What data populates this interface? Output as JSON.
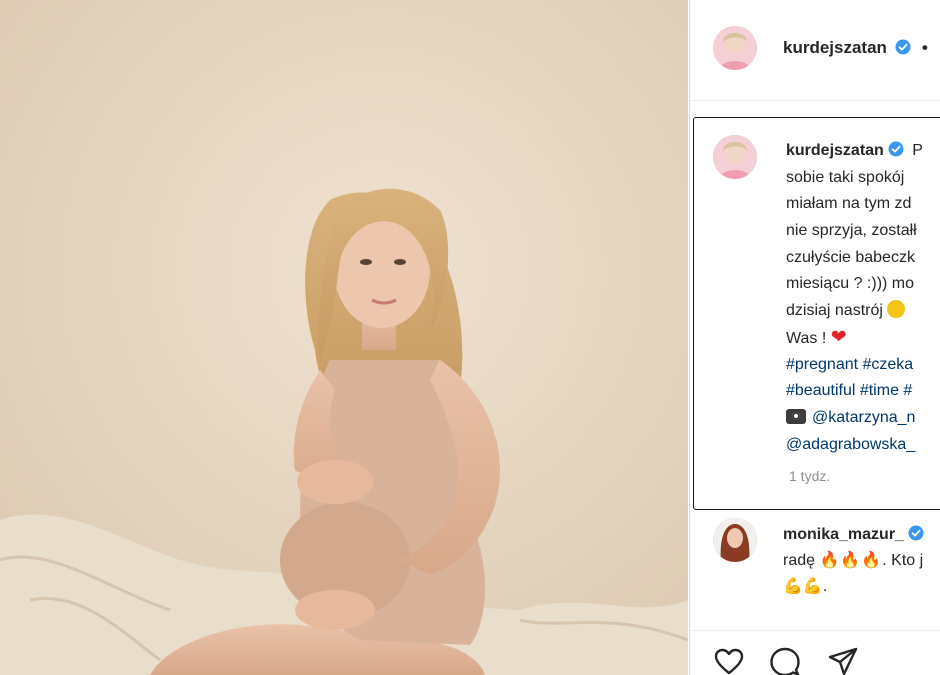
{
  "post": {
    "username": "kurdejszatan",
    "header_separator": "•",
    "caption_lines": [
      "P",
      "sobie taki spokój",
      "miałam na tym zd",
      "nie sprzyja, zostałł",
      "czułyście babeczk",
      "miesiącu ? :))) mo",
      "dzisiaj nastrój",
      "Was !"
    ],
    "hashtag_lines": [
      "#pregnant #czeka",
      "#beautiful #time #"
    ],
    "mention_lines": [
      "@katarzyna_n",
      "@adagrabowska_"
    ],
    "timestamp": "1 tydz."
  },
  "comment": {
    "username": "monika_mazur_",
    "line1": "radę",
    "line1_suffix": ". Kto j",
    "line2_suffix": "."
  },
  "icons": {
    "verified": "verified-badge-icon",
    "like": "heart-outline-icon",
    "comment": "comment-bubble-icon",
    "share": "paper-plane-icon"
  },
  "colors": {
    "verified_blue": "#3897f0",
    "link_blue": "#00376b",
    "timestamp_gray": "#8e8e8e"
  }
}
